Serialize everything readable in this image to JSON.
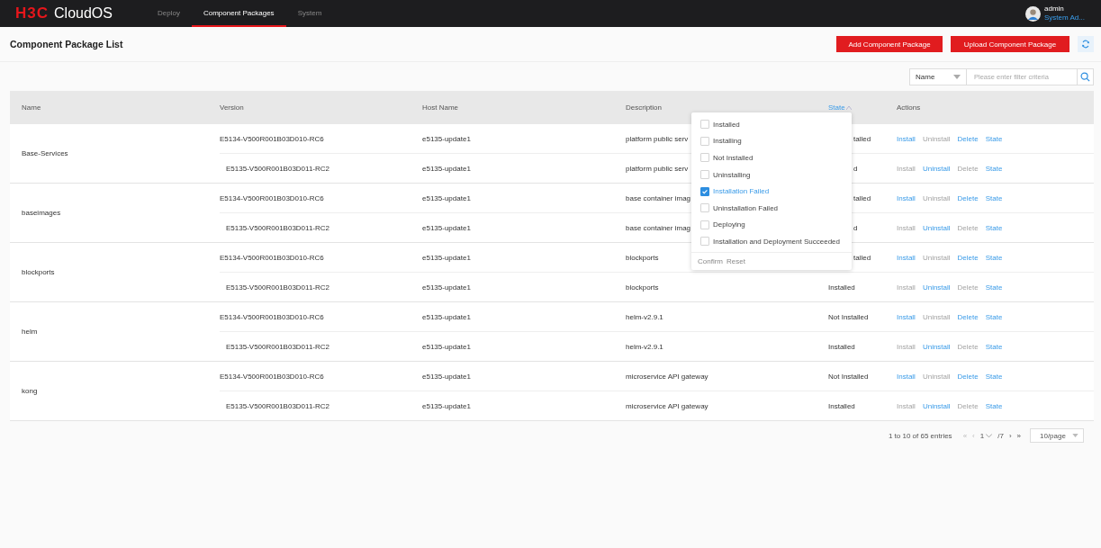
{
  "top_bar": {
    "logo_mark": "H3C",
    "logo_text": "CloudOS",
    "nav": [
      {
        "label": "Deploy",
        "selected": false
      },
      {
        "label": "Component Packages",
        "selected": true
      },
      {
        "label": "System",
        "selected": false
      }
    ],
    "user": {
      "name": "admin",
      "role": "System Ad..."
    }
  },
  "page": {
    "title": "Component Package List",
    "buttons": [
      "Add Component Package",
      "Upload Component Package"
    ]
  },
  "filter": {
    "field": "Name",
    "placeholder": "Please enter filter criteria"
  },
  "table": {
    "columns": [
      {
        "label": "Name",
        "active": false
      },
      {
        "label": "Version",
        "active": false
      },
      {
        "label": "Host Name",
        "active": false
      },
      {
        "label": "Description",
        "active": false
      },
      {
        "label": "State",
        "active": true
      },
      {
        "label": "Actions",
        "active": false
      }
    ],
    "groups": [
      {
        "name": "Base-Services",
        "rows": [
          {
            "version": "E5134-V500R001B03D010-RC6",
            "host": "e5135-update1",
            "description": "platform public serv",
            "state": "talled",
            "state_cut": true,
            "actions": [
              {
                "label": "Install",
                "disabled": false
              },
              {
                "label": "Uninstall",
                "disabled": true
              },
              {
                "label": "Delete",
                "disabled": false
              },
              {
                "label": "State",
                "disabled": false
              }
            ]
          },
          {
            "version": "E5135-V500R001B03D011-RC2",
            "host": "e5135-update1",
            "description": "platform public serv",
            "state": "d",
            "state_cut": true,
            "actions": [
              {
                "label": "Install",
                "disabled": true
              },
              {
                "label": "Uninstall",
                "disabled": false
              },
              {
                "label": "Delete",
                "disabled": true
              },
              {
                "label": "State",
                "disabled": false
              }
            ]
          }
        ]
      },
      {
        "name": "baseimages",
        "rows": [
          {
            "version": "E5134-V500R001B03D010-RC6",
            "host": "e5135-update1",
            "description": "base container imag",
            "state": "talled",
            "state_cut": true,
            "actions": [
              {
                "label": "Install",
                "disabled": false
              },
              {
                "label": "Uninstall",
                "disabled": true
              },
              {
                "label": "Delete",
                "disabled": false
              },
              {
                "label": "State",
                "disabled": false
              }
            ]
          },
          {
            "version": "E5135-V500R001B03D011-RC2",
            "host": "e5135-update1",
            "description": "base container imag",
            "state": "d",
            "state_cut": true,
            "actions": [
              {
                "label": "Install",
                "disabled": true
              },
              {
                "label": "Uninstall",
                "disabled": false
              },
              {
                "label": "Delete",
                "disabled": true
              },
              {
                "label": "State",
                "disabled": false
              }
            ]
          }
        ]
      },
      {
        "name": "blockports",
        "rows": [
          {
            "version": "E5134-V500R001B03D010-RC6",
            "host": "e5135-update1",
            "description": "blockports",
            "state": "talled",
            "state_cut": true,
            "actions": [
              {
                "label": "Install",
                "disabled": false
              },
              {
                "label": "Uninstall",
                "disabled": true
              },
              {
                "label": "Delete",
                "disabled": false
              },
              {
                "label": "State",
                "disabled": false
              }
            ]
          },
          {
            "version": "E5135-V500R001B03D011-RC2",
            "host": "e5135-update1",
            "description": "blockports",
            "state": "Installed",
            "actions": [
              {
                "label": "Install",
                "disabled": true
              },
              {
                "label": "Uninstall",
                "disabled": false
              },
              {
                "label": "Delete",
                "disabled": true
              },
              {
                "label": "State",
                "disabled": false
              }
            ]
          }
        ]
      },
      {
        "name": "helm",
        "rows": [
          {
            "version": "E5134-V500R001B03D010-RC6",
            "host": "e5135-update1",
            "description": "helm-v2.9.1",
            "state": "Not Installed",
            "actions": [
              {
                "label": "Install",
                "disabled": false
              },
              {
                "label": "Uninstall",
                "disabled": true
              },
              {
                "label": "Delete",
                "disabled": false
              },
              {
                "label": "State",
                "disabled": false
              }
            ]
          },
          {
            "version": "E5135-V500R001B03D011-RC2",
            "host": "e5135-update1",
            "description": "helm-v2.9.1",
            "state": "Installed",
            "actions": [
              {
                "label": "Install",
                "disabled": true
              },
              {
                "label": "Uninstall",
                "disabled": false
              },
              {
                "label": "Delete",
                "disabled": true
              },
              {
                "label": "State",
                "disabled": false
              }
            ]
          }
        ]
      },
      {
        "name": "kong",
        "rows": [
          {
            "version": "E5134-V500R001B03D010-RC6",
            "host": "e5135-update1",
            "description": "microservice API gateway",
            "state": "Not Installed",
            "actions": [
              {
                "label": "Install",
                "disabled": false
              },
              {
                "label": "Uninstall",
                "disabled": true
              },
              {
                "label": "Delete",
                "disabled": false
              },
              {
                "label": "State",
                "disabled": false
              }
            ]
          },
          {
            "version": "E5135-V500R001B03D011-RC2",
            "host": "e5135-update1",
            "description": "microservice API gateway",
            "state": "Installed",
            "actions": [
              {
                "label": "Install",
                "disabled": true
              },
              {
                "label": "Uninstall",
                "disabled": false
              },
              {
                "label": "Delete",
                "disabled": true
              },
              {
                "label": "State",
                "disabled": false
              }
            ]
          }
        ]
      }
    ]
  },
  "state_filter": {
    "options": [
      {
        "label": "Installed",
        "checked": false
      },
      {
        "label": "Installing",
        "checked": false
      },
      {
        "label": "Not Installed",
        "checked": false
      },
      {
        "label": "Uninstalling",
        "checked": false
      },
      {
        "label": "Installation Failed",
        "checked": true
      },
      {
        "label": "Uninstallation Failed",
        "checked": false
      },
      {
        "label": "Deploying",
        "checked": false
      },
      {
        "label": "Installation and Deployment Succeeded",
        "checked": false
      }
    ],
    "confirm": "Confirm",
    "reset": "Reset"
  },
  "pagination": {
    "summary": "1 to 10 of 65 entries",
    "first": "«",
    "prev": "‹",
    "page": "1",
    "total": "/7",
    "next": "›",
    "last": "»",
    "page_size": "10/page"
  }
}
